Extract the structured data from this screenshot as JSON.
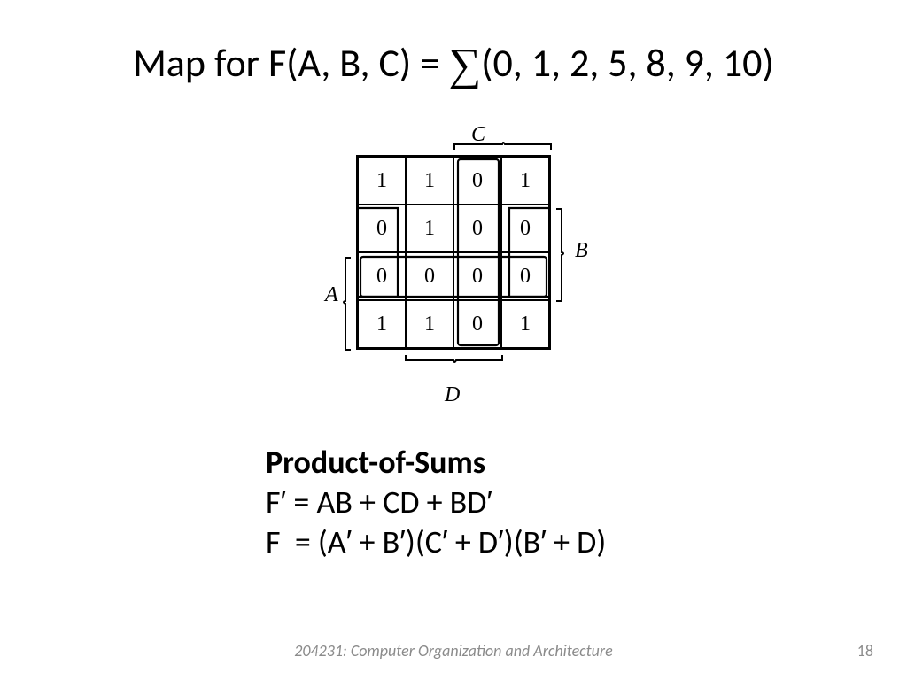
{
  "title": {
    "prefix": "Map for F(A, B, C) = ",
    "sigma": "∑",
    "suffix": "(0, 1, 2, 5, 8, 9, 10)"
  },
  "kmap": {
    "labels": {
      "C": "C",
      "D": "D",
      "A": "A",
      "B": "B"
    },
    "cells": [
      [
        "1",
        "1",
        "0",
        "1"
      ],
      [
        "0",
        "1",
        "0",
        "0"
      ],
      [
        "0",
        "0",
        "0",
        "0"
      ],
      [
        "1",
        "1",
        "0",
        "1"
      ]
    ]
  },
  "formulas": {
    "heading": "Product-of-Sums",
    "line1": "F′ = AB + CD + BD′",
    "line2": "F  = (A′ + B′)(C′ + D′)(B′ + D)"
  },
  "footer": {
    "course": "204231: Computer Organization and Architecture",
    "page": "18"
  }
}
